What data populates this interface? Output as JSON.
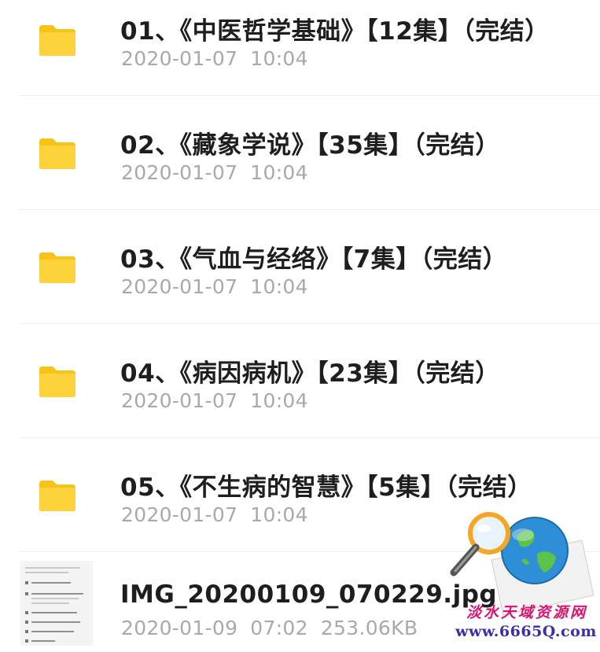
{
  "files": [
    {
      "type": "folder",
      "icon": "folder-icon",
      "name": "01、《中医哲学基础》【12集】（完结）",
      "date": "2020-01-07",
      "time": "10:04"
    },
    {
      "type": "folder",
      "icon": "folder-icon",
      "name": "02、《藏象学说》【35集】（完结）",
      "date": "2020-01-07",
      "time": "10:04"
    },
    {
      "type": "folder",
      "icon": "folder-icon",
      "name": "03、《气血与经络》【7集】（完结）",
      "date": "2020-01-07",
      "time": "10:04"
    },
    {
      "type": "folder",
      "icon": "folder-icon",
      "name": "04、《病因病机》【23集】（完结）",
      "date": "2020-01-07",
      "time": "10:04"
    },
    {
      "type": "folder",
      "icon": "folder-icon",
      "name": "05、《不生病的智慧》【5集】（完结）",
      "date": "2020-01-07",
      "time": "10:04"
    },
    {
      "type": "image",
      "icon": "image-thumbnail",
      "name": "IMG_20200109_070229.jpg",
      "date": "2020-01-09",
      "time": "07:02",
      "size": "253.06KB"
    }
  ],
  "watermark": {
    "name": "淡水天域资源网",
    "url": "www.6665Q.com"
  },
  "colors": {
    "folder": "#fdd23a",
    "folder_tab": "#f6c318",
    "title_text": "#1e1e1e",
    "meta_text": "#a9a9a9",
    "watermark_name": "#d9156e",
    "watermark_url": "#3b2fa8"
  }
}
